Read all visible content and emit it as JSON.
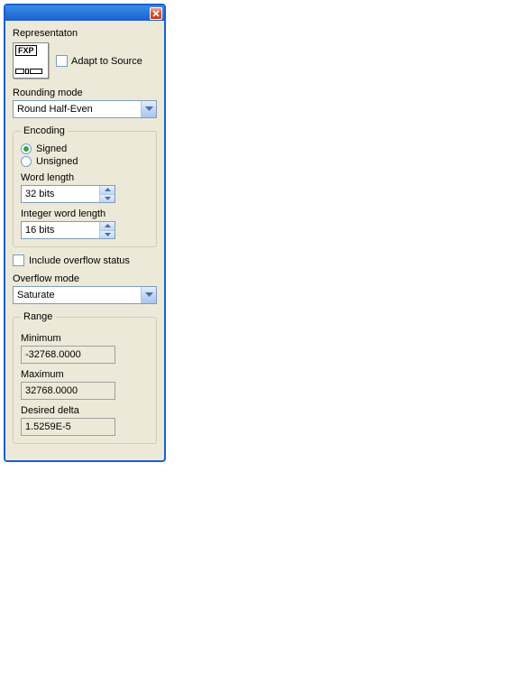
{
  "representation": {
    "label": "Representaton",
    "icon_text": "FXP",
    "adapt_label": "Adapt to Source",
    "adapt_checked": false
  },
  "rounding": {
    "label": "Rounding mode",
    "value": "Round Half-Even"
  },
  "encoding": {
    "legend": "Encoding",
    "signed_label": "Signed",
    "unsigned_label": "Unsigned",
    "selected": "signed",
    "word_length_label": "Word length",
    "word_length_value": "32 bits",
    "int_word_length_label": "Integer word length",
    "int_word_length_value": "16 bits"
  },
  "overflow_status": {
    "label": "Include overflow status",
    "checked": false
  },
  "overflow_mode": {
    "label": "Overflow mode",
    "value": "Saturate"
  },
  "range": {
    "legend": "Range",
    "minimum_label": "Minimum",
    "minimum_value": "-32768.0000",
    "maximum_label": "Maximum",
    "maximum_value": "32768.0000",
    "delta_label": "Desired delta",
    "delta_value": "1.5259E-5"
  }
}
